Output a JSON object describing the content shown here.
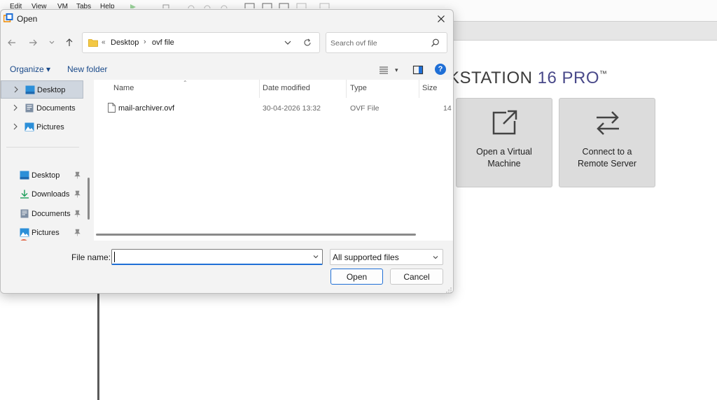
{
  "background": {
    "menu": [
      "Edit",
      "View",
      "VM",
      "Tabs",
      "Help"
    ],
    "brand_prefix": "KSTATION ",
    "brand_number": "16",
    "brand_suffix": " PRO",
    "brand_tm": "™",
    "tiles": [
      {
        "label": "Open a Virtual\nMachine",
        "icon": "open-external-icon"
      },
      {
        "label": "Connect to a\nRemote Server",
        "icon": "swap-arrows-icon"
      }
    ]
  },
  "dialog": {
    "title": "Open",
    "address": {
      "overflow": "«",
      "crumbs": [
        "Desktop",
        "ovf file"
      ],
      "separator": "›"
    },
    "search_placeholder": "Search ovf file",
    "commands": {
      "organize": "Organize ▾",
      "new_folder": "New folder",
      "view_menu": "▾",
      "help": "?"
    },
    "tree": [
      {
        "label": "Desktop",
        "icon": "desktop-folder-icon",
        "selected": true
      },
      {
        "label": "Documents",
        "icon": "documents-folder-icon"
      },
      {
        "label": "Pictures",
        "icon": "pictures-folder-icon"
      }
    ],
    "quick_access": [
      {
        "label": "Desktop",
        "icon": "desktop-folder-icon"
      },
      {
        "label": "Downloads",
        "icon": "downloads-folder-icon"
      },
      {
        "label": "Documents",
        "icon": "documents-folder-icon"
      },
      {
        "label": "Pictures",
        "icon": "pictures-folder-icon"
      }
    ],
    "columns": [
      "Name",
      "Date modified",
      "Type",
      "Size"
    ],
    "files": [
      {
        "name": "mail-archiver.ovf",
        "date": "30-04-2026 13:32",
        "type": "OVF File",
        "size": "14"
      }
    ],
    "file_name_label": "File name:",
    "file_name_value": "",
    "file_type": "All supported files",
    "open_label": "Open",
    "cancel_label": "Cancel"
  },
  "colors": {
    "accent": "#1f6fd6",
    "link": "#1a4a8a",
    "dialog_bg": "#f3f3f3",
    "tile_bg": "#dcdcdc"
  }
}
